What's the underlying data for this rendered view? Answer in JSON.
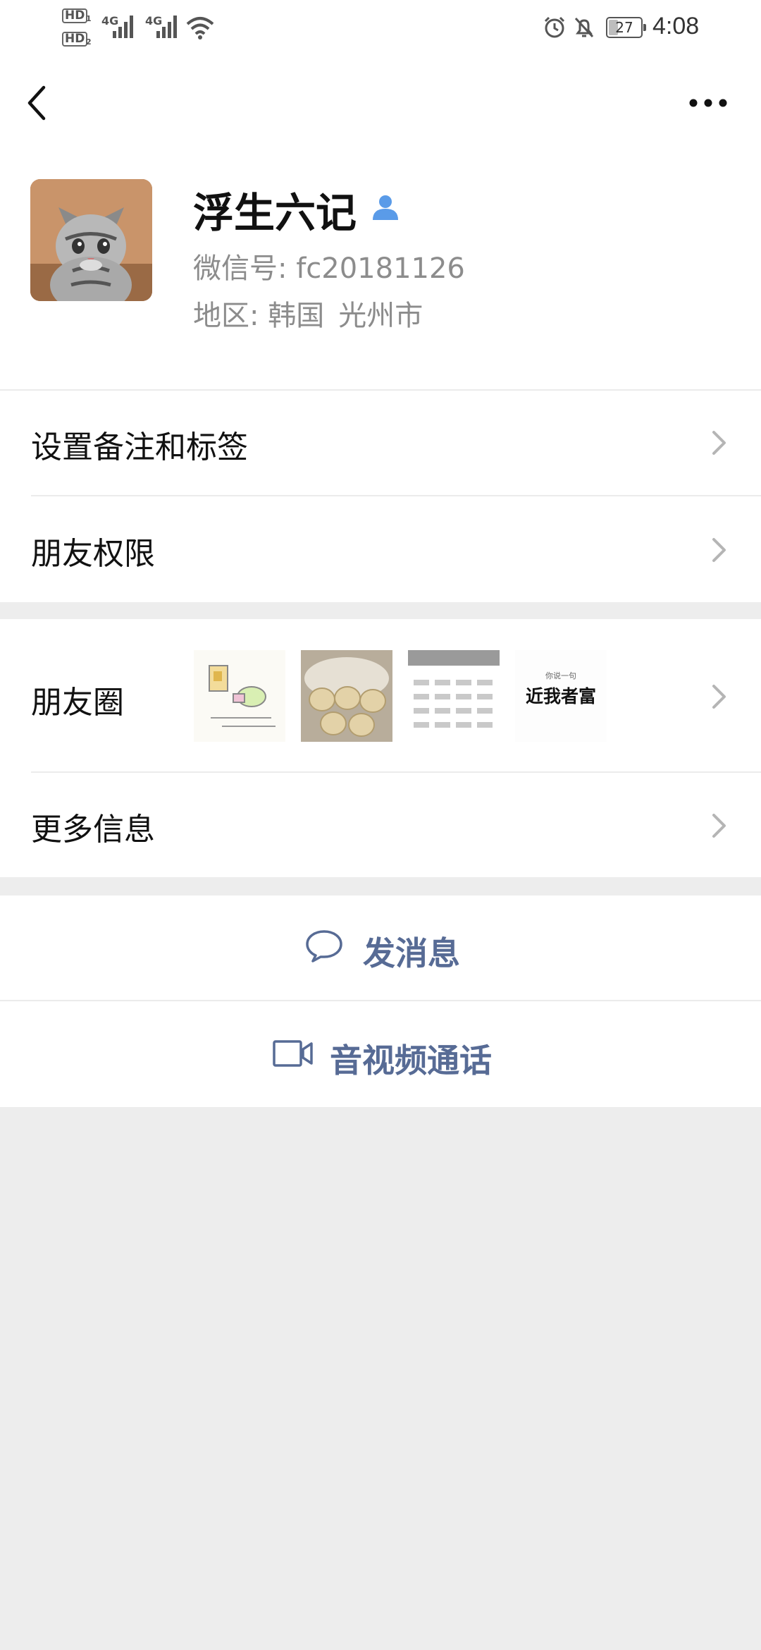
{
  "status_bar": {
    "hd1": "HD",
    "hd1_sub": "1",
    "hd2": "HD",
    "hd2_sub": "2",
    "net1": "4G",
    "net2": "4G",
    "battery": "27",
    "time": "4:08"
  },
  "nav": {
    "back_icon": "chevron-left-icon",
    "more_icon": "more-dots-icon"
  },
  "profile": {
    "name": "浮生六记",
    "wechat_id_label": "微信号:",
    "wechat_id": "fc20181126",
    "region_label": "地区:",
    "region_country": "韩国",
    "region_city": "光州市",
    "contact_icon": "person-icon"
  },
  "menu": {
    "set_remark": "设置备注和标签",
    "friend_permissions": "朋友权限",
    "moments": "朋友圈",
    "more_info": "更多信息"
  },
  "moments_thumbs": {
    "thumb4_small": "你说一句",
    "thumb4_big": "近我者富"
  },
  "actions": {
    "send_message": "发消息",
    "call": "音视频通话"
  },
  "colors": {
    "link": "#576b95",
    "background": "#ededed",
    "card": "#ffffff"
  }
}
